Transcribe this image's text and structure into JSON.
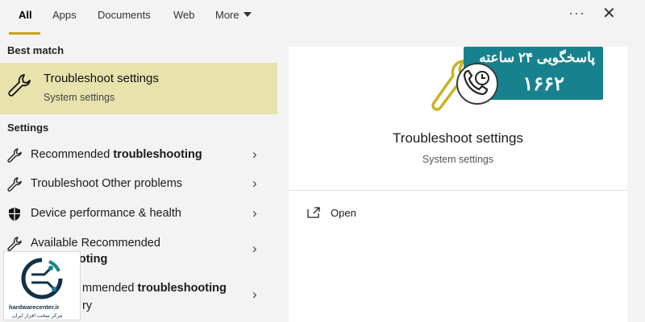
{
  "tabs": [
    {
      "label": "All",
      "active": true
    },
    {
      "label": "Apps"
    },
    {
      "label": "Documents"
    },
    {
      "label": "Web"
    },
    {
      "label": "More"
    }
  ],
  "toolbar": {
    "ellipsis": "···",
    "close": "✕"
  },
  "left": {
    "best_match_heading": "Best match",
    "best_match": {
      "title": "Troubleshoot settings",
      "subtitle": "System settings",
      "icon": "wrench-icon"
    },
    "settings_heading": "Settings",
    "items": [
      {
        "pre": "Recommended ",
        "bold": "troubleshooting",
        "post": "",
        "icon": "wrench-icon"
      },
      {
        "pre": "Troubleshoot Other problems",
        "bold": "",
        "post": "",
        "icon": "wrench-icon"
      },
      {
        "pre": "Device performance & health",
        "bold": "",
        "post": "",
        "icon": "shield-icon"
      },
      {
        "pre": "Available Recommended",
        "line2": "leshooting",
        "icon": "wrench-icon"
      },
      {
        "pre": "mmended ",
        "bold": "troubleshooting",
        "line2": "ry",
        "icon": "wrench-icon"
      }
    ]
  },
  "right": {
    "title": "Troubleshoot settings",
    "subtitle": "System settings",
    "open_label": "Open"
  },
  "promo": {
    "line1": "پاسخگویی ۲۴ ساعته",
    "line2": "۱۶۶۲"
  },
  "logo": {
    "name": "hardwarecenter.ir",
    "tagline": "مرکز سخت افزار ایران"
  },
  "colors": {
    "highlight": "#e8e2ad",
    "accent": "#c8a318",
    "promo": "#17828e"
  }
}
